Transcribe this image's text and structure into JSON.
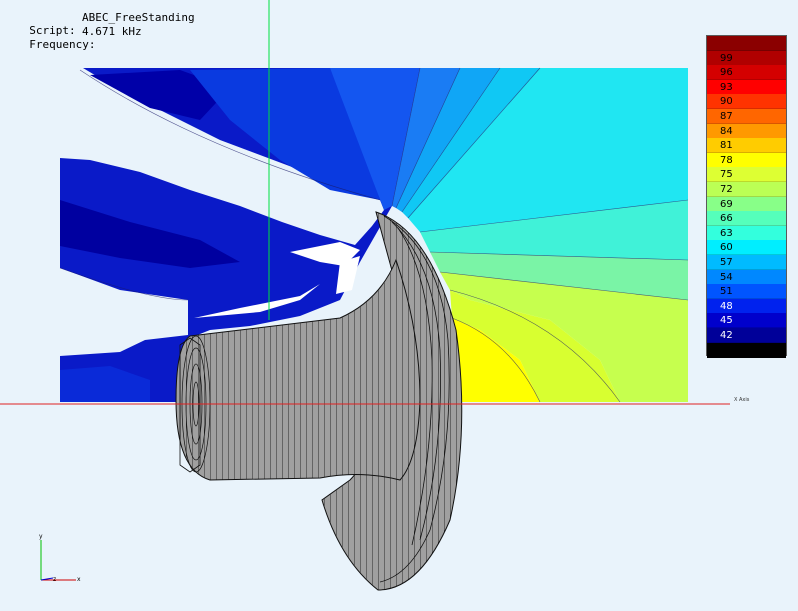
{
  "info": {
    "script_label": "Script:",
    "script_value": "ABEC_FreeStanding",
    "frequency_label": "Frequency:",
    "frequency_value": "4.671 kHz"
  },
  "legend": {
    "entries": [
      {
        "value": "",
        "color": "#8b0000"
      },
      {
        "value": "99",
        "color": "#b00000"
      },
      {
        "value": "96",
        "color": "#d40000"
      },
      {
        "value": "93",
        "color": "#ff0000"
      },
      {
        "value": "90",
        "color": "#ff3300"
      },
      {
        "value": "87",
        "color": "#ff6600"
      },
      {
        "value": "84",
        "color": "#ff9900"
      },
      {
        "value": "81",
        "color": "#ffcc00"
      },
      {
        "value": "78",
        "color": "#ffff00"
      },
      {
        "value": "75",
        "color": "#ddff33"
      },
      {
        "value": "72",
        "color": "#bbff55"
      },
      {
        "value": "69",
        "color": "#88ff88"
      },
      {
        "value": "66",
        "color": "#55ffbb"
      },
      {
        "value": "63",
        "color": "#33ffdd"
      },
      {
        "value": "60",
        "color": "#00eeff"
      },
      {
        "value": "57",
        "color": "#00bbff"
      },
      {
        "value": "54",
        "color": "#0088ff"
      },
      {
        "value": "51",
        "color": "#0055ff"
      },
      {
        "value": "48",
        "color": "#0022ee"
      },
      {
        "value": "45",
        "color": "#0000cc"
      },
      {
        "value": "42",
        "color": "#000099"
      },
      {
        "value": "",
        "color": "#000000"
      }
    ]
  },
  "axis_label": "X Axis",
  "triad": {
    "x": "x",
    "y": "y",
    "z": "z"
  }
}
